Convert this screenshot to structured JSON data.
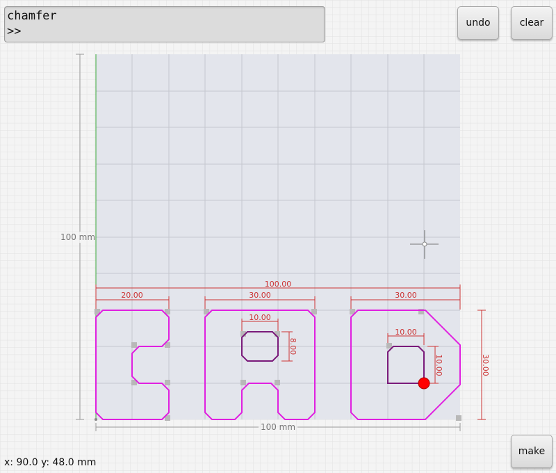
{
  "command": {
    "line1": "chamfer",
    "prompt": ">>"
  },
  "buttons": {
    "undo": "undo",
    "clear": "clear",
    "make": "make"
  },
  "dimensions": {
    "total_width": "100.00",
    "letter_c_width": "20.00",
    "letter_a_width": "30.00",
    "letter_d_width": "30.00",
    "a_hole_width": "10.00",
    "a_hole_height": "8.00",
    "d_hole_width": "10.00",
    "d_hole_height": "10.00",
    "height": "30.00",
    "axis_y": "100 mm",
    "axis_x": "100 mm"
  },
  "status": "x: 90.0 y: 48.0 mm",
  "colors": {
    "shape": "#e020e0",
    "hole": "#7a1a7a",
    "dimension": "#cc3333",
    "canvas": "#e3e5ec",
    "point": "#ff0000"
  }
}
